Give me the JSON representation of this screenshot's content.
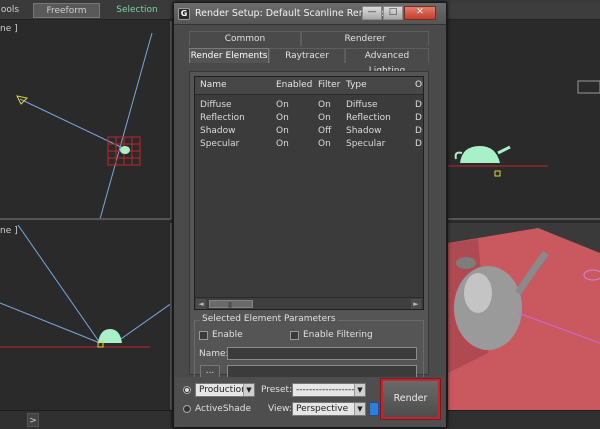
{
  "ribbon": {
    "tabs": [
      {
        "label": "ools"
      },
      {
        "label": "Freeform"
      },
      {
        "label": "Selection"
      }
    ]
  },
  "viewports": {
    "top_left_label": "ne ]",
    "bottom_left_label": "ne ]"
  },
  "statusbar": {
    "button": ">"
  },
  "dialog": {
    "title": "Render Setup: Default Scanline Renderer",
    "app_icon_glyph": "G",
    "window_buttons": {
      "minimize": "—",
      "maximize": "□",
      "close": "✕"
    },
    "tabs_row1": [
      {
        "label": "Common"
      },
      {
        "label": "Renderer"
      }
    ],
    "tabs_row2": [
      {
        "label": "Render Elements"
      },
      {
        "label": "Raytracer"
      },
      {
        "label": "Advanced Lighting"
      }
    ],
    "list": {
      "columns": [
        "Name",
        "Enabled",
        "Filter",
        "Type",
        "Ou"
      ],
      "rows": [
        {
          "name": "Diffuse",
          "enabled": "On",
          "filter": "On",
          "type": "Diffuse",
          "out": "D:\\"
        },
        {
          "name": "Reflection",
          "enabled": "On",
          "filter": "On",
          "type": "Reflection",
          "out": "D:\\"
        },
        {
          "name": "Shadow",
          "enabled": "On",
          "filter": "Off",
          "type": "Shadow",
          "out": "D:\\"
        },
        {
          "name": "Specular",
          "enabled": "On",
          "filter": "On",
          "type": "Specular",
          "out": "D:\\"
        }
      ]
    },
    "selected_params": {
      "title": "Selected Element Parameters",
      "enable_label": "Enable",
      "enable_filtering_label": "Enable Filtering",
      "name_label": "Name:",
      "name_value": "",
      "path_value": "",
      "browse_label": "..."
    },
    "bottom": {
      "production_radio": "",
      "activeshade_label": "ActiveShade",
      "mode_value": "Production",
      "preset_label": "Preset:",
      "preset_value": "--------------------",
      "view_label": "View:",
      "view_value": "Perspective",
      "render_label": "Render"
    }
  },
  "colors": {
    "render_button_border": "#c0262d",
    "close_button": "#c1402c",
    "viewport_bg": "#2a2a2a",
    "teapot_green": "#a8f0c8",
    "floor_red": "#c9585f"
  }
}
